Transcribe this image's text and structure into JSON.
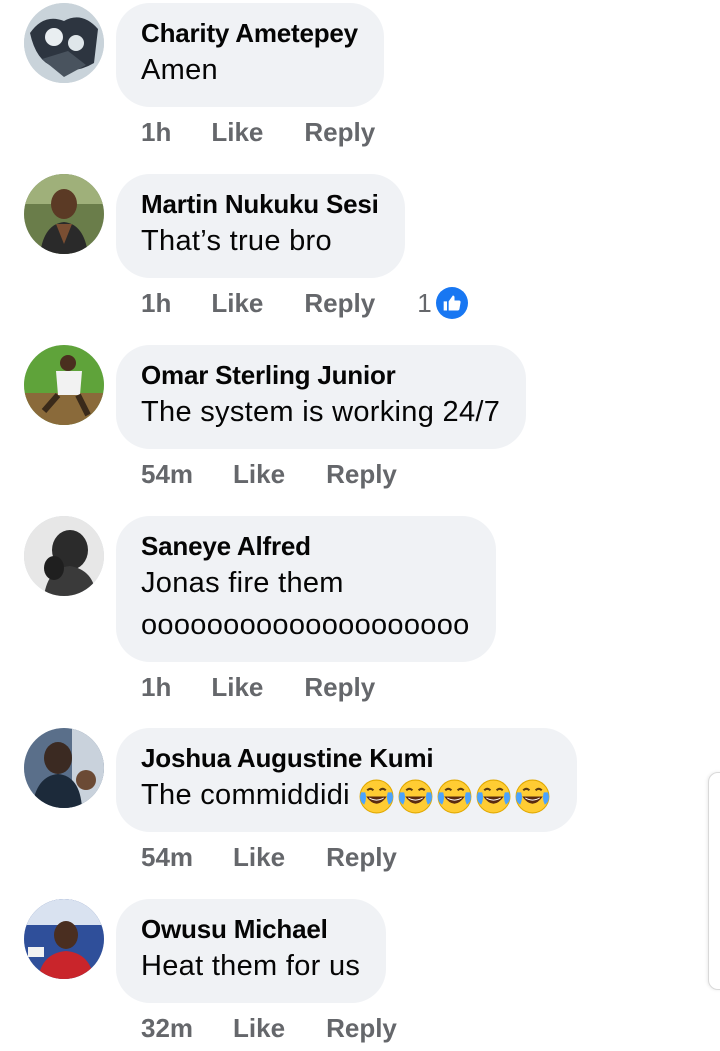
{
  "comments": [
    {
      "author": "Charity Ametepey",
      "text": "Amen",
      "time": "1h",
      "like_label": "Like",
      "reply_label": "Reply"
    },
    {
      "author": "Martin Nukuku Sesi",
      "text": "That’s true bro",
      "time": "1h",
      "like_label": "Like",
      "reply_label": "Reply",
      "reaction_count": "1",
      "reaction_icon": "thumbs-up-icon"
    },
    {
      "author": "Omar Sterling Junior",
      "text": "The system is working 24/7",
      "time": "54m",
      "like_label": "Like",
      "reply_label": "Reply"
    },
    {
      "author": "Saneye Alfred",
      "text": "Jonas fire them\noooooooooooooooooooo",
      "time": "1h",
      "like_label": "Like",
      "reply_label": "Reply"
    },
    {
      "author": "Joshua Augustine Kumi",
      "text": "The commiddidi",
      "emoji": "face-with-tears-of-joy-icon",
      "emoji_count": 5,
      "time": "54m",
      "like_label": "Like",
      "reply_label": "Reply"
    },
    {
      "author": "Owusu Michael",
      "text": "Heat them for us",
      "time": "32m",
      "like_label": "Like",
      "reply_label": "Reply"
    }
  ],
  "colors": {
    "bubble_bg": "#f0f2f5",
    "meta_text": "#65676b",
    "like_blue": "#1877f2"
  }
}
